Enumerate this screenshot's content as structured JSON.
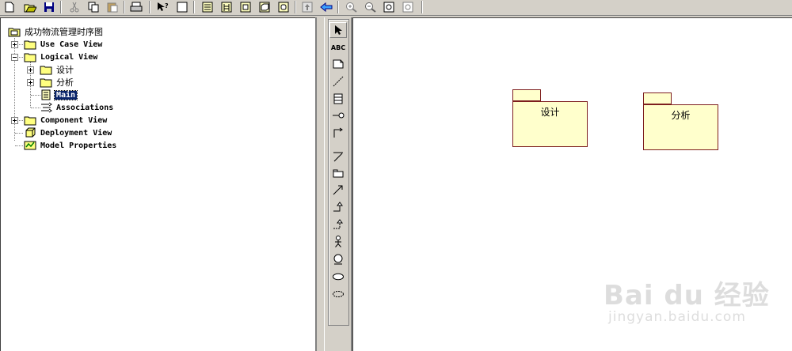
{
  "toolbar": {
    "buttons": [
      "new-icon",
      "open-icon",
      "save-icon",
      "cut-icon",
      "copy-icon",
      "paste-icon",
      "print-icon",
      "context-help-icon",
      "view-doc-icon",
      "browse-class-icon",
      "browse-interaction-icon",
      "browse-component-icon",
      "browse-deployment-icon",
      "browse-statechart-icon",
      "browse-parent-icon",
      "browse-previous-icon",
      "zoom-in-icon",
      "zoom-out-icon",
      "fit-window-icon",
      "undo-fit-icon"
    ]
  },
  "tree": {
    "root": "成功物流管理时序图",
    "use_case_view": "Use Case View",
    "logical_view": "Logical View",
    "pkg_design": "设计",
    "pkg_analysis": "分析",
    "main": "Main",
    "associations": "Associations",
    "component_view": "Component View",
    "deployment_view": "Deployment View",
    "model_properties": "Model Properties"
  },
  "palette": {
    "tools": [
      "selection-arrow-icon",
      "text-box-icon",
      "note-icon",
      "anchor-note-icon",
      "class-icon",
      "interface-icon",
      "unidirectional-association-icon",
      "association-class-icon",
      "package-icon",
      "dependency-icon",
      "generalization-icon",
      "realization-icon",
      "actor-icon",
      "boundary-icon",
      "use-case-icon",
      "ellipse-icon"
    ],
    "text_tool_label": "ABC"
  },
  "diagram": {
    "packages": [
      {
        "name": "设计"
      },
      {
        "name": "分析"
      }
    ]
  },
  "watermark": {
    "main": "Bai du 经验",
    "sub": "jingyan.baidu.com"
  }
}
